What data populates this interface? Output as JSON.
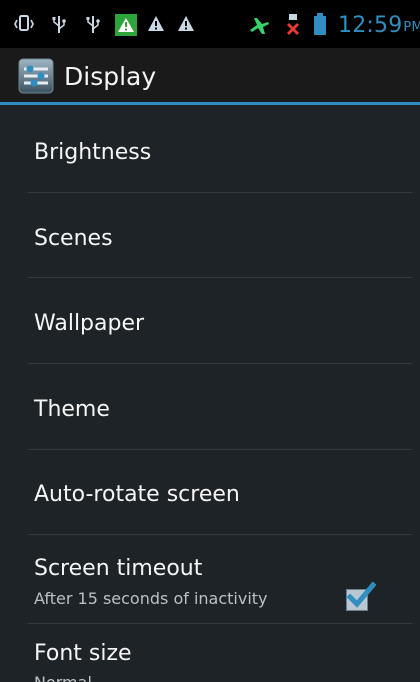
{
  "status_bar": {
    "time": "12:59",
    "ampm": "PM",
    "icons": [
      "vibrate-icon",
      "usb-icon",
      "usb-icon",
      "warning-triangle-highlight-icon",
      "warning-triangle-icon",
      "warning-triangle-icon",
      "airplane-icon",
      "sim-card-icon",
      "battery-icon"
    ],
    "colors": {
      "time": "#2f8ec0",
      "highlight_green": "#2ca53a"
    }
  },
  "action_bar": {
    "title": "Display",
    "app_icon": "settings-sliders-icon",
    "accent": "#2f8ec0"
  },
  "settings": {
    "items": [
      {
        "title": "Brightness"
      },
      {
        "title": "Scenes"
      },
      {
        "title": "Wallpaper"
      },
      {
        "title": "Theme"
      },
      {
        "title": "Auto-rotate screen",
        "checked": true
      },
      {
        "title": "Screen timeout",
        "subtitle": "After 15 seconds of inactivity"
      },
      {
        "title": "Font size",
        "subtitle": "Normal"
      }
    ]
  }
}
